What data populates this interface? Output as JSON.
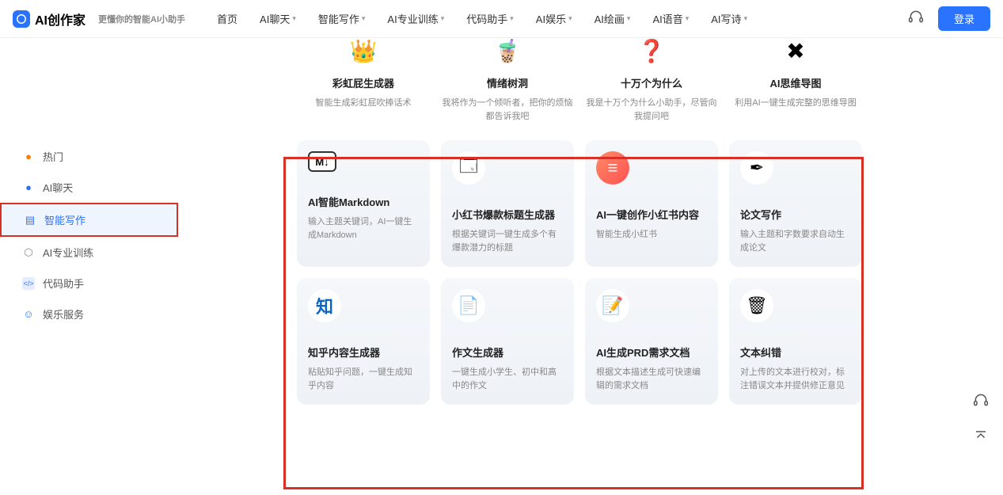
{
  "header": {
    "brand": "AI创作家",
    "slogan": "更懂你的智能AI小助手",
    "nav": [
      "首页",
      "AI聊天",
      "智能写作",
      "AI专业训练",
      "代码助手",
      "AI娱乐",
      "AI绘画",
      "AI语音",
      "AI写诗"
    ],
    "login": "登录"
  },
  "sidebar": {
    "items": [
      {
        "label": "热门",
        "icon": "🔥"
      },
      {
        "label": "AI聊天",
        "icon": "💬"
      },
      {
        "label": "智能写作",
        "icon": "📝"
      },
      {
        "label": "AI专业训练",
        "icon": "⚙"
      },
      {
        "label": "代码助手",
        "icon": "</>"
      },
      {
        "label": "娱乐服务",
        "icon": "☺"
      }
    ],
    "active_index": 2
  },
  "top_cards": [
    {
      "title": "彩虹屁生成器",
      "desc": "智能生成彩虹屁吹捧话术",
      "icon": "🌈"
    },
    {
      "title": "情绪树洞",
      "desc": "我将作为一个倾听者，把你的烦恼都告诉我吧",
      "icon": "🧋"
    },
    {
      "title": "十万个为什么",
      "desc": "我是十万个为什么小助手，尽管向我提问吧",
      "icon": "❓"
    },
    {
      "title": "AI思维导图",
      "desc": "利用AI一键生成完整的思维导图",
      "icon": "✖"
    }
  ],
  "cards": [
    {
      "title": "AI智能Markdown",
      "desc": "输入主题关键词，AI一键生成Markdown",
      "icon": "M↓"
    },
    {
      "title": "小红书爆款标题生成器",
      "desc": "根据关键词一键生成多个有爆款潜力的标题",
      "icon": "🗔"
    },
    {
      "title": "AI一键创作小红书内容",
      "desc": "智能生成小红书",
      "icon": "📕"
    },
    {
      "title": "论文写作",
      "desc": "输入主题和字数要求自动生成论文",
      "icon": "✒"
    },
    {
      "title": "知乎内容生成器",
      "desc": "粘贴知乎问题，一键生成知乎内容",
      "icon": "知"
    },
    {
      "title": "作文生成器",
      "desc": "一键生成小学生、初中和高中的作文",
      "icon": "📄"
    },
    {
      "title": "AI生成PRD需求文档",
      "desc": "根据文本描述生成可快速编辑的需求文档",
      "icon": "🗎"
    },
    {
      "title": "文本纠错",
      "desc": "对上传的文本进行校对，标注错误文本并提供修正意见",
      "icon": "🗑"
    }
  ]
}
